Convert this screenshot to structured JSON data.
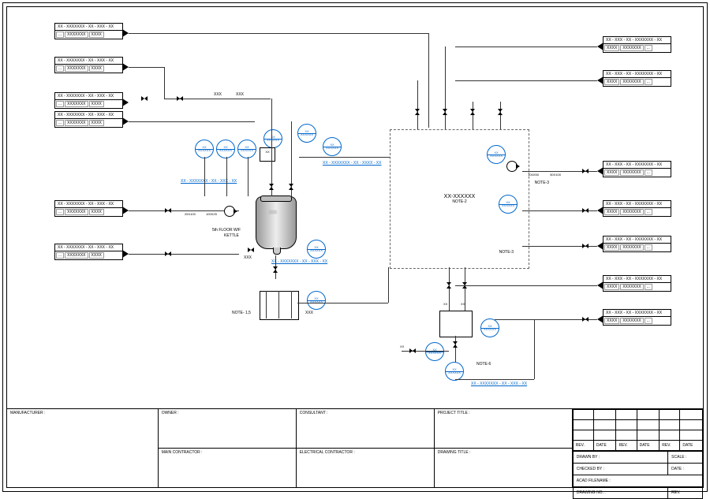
{
  "tags": {
    "left": [
      {
        "hdr": "XX - XXXXXXX - XX - XXX - XX",
        "row": [
          "...",
          "XXXXXXX",
          "XXXX"
        ]
      },
      {
        "hdr": "XX - XXXXXXX - XX - XXX - XX",
        "row": [
          "...",
          "XXXXXXX",
          "XXXX"
        ]
      },
      {
        "hdr": "XX - XXXXXXX - XX - XXX - XX",
        "row": [
          "...",
          "XXXXXXX",
          "XXXX"
        ]
      },
      {
        "hdr": "XX - XXXXXXX - XX - XXX - XX",
        "row": [
          "...",
          "XXXXXXX",
          "XXXX"
        ]
      },
      {
        "hdr": "XX - XXXXXXX - XX - XXX - XX",
        "row": [
          "...",
          "XXXXXXX",
          "XXXX"
        ]
      },
      {
        "hdr": "XX - XXXXXXX - XX - XXX - XX",
        "row": [
          "...",
          "XXXXXXX",
          "XXXX"
        ]
      }
    ],
    "right": [
      {
        "hdr": "XX - XXX - XX - XXXXXXX - XX",
        "row": [
          "XXXX",
          "XXXXXXX",
          "..."
        ]
      },
      {
        "hdr": "XX - XXX - XX - XXXXXXX - XX",
        "row": [
          "XXXX",
          "XXXXXXX",
          "..."
        ]
      },
      {
        "hdr": "XX - XXX - XX - XXXXXXX - XX",
        "row": [
          "XXXX",
          "XXXXXXX",
          "..."
        ]
      },
      {
        "hdr": "XX - XXX - XX - XXXXXXX - XX",
        "row": [
          "XXXX",
          "XXXXXXX",
          "..."
        ]
      },
      {
        "hdr": "XX - XXX - XX - XXXXXXX - XX",
        "row": [
          "XXXX",
          "XXXXXXX",
          "..."
        ]
      },
      {
        "hdr": "XX - XXX - XX - XXXXXXX - XX",
        "row": [
          "XXXX",
          "XXXXXXX",
          "..."
        ]
      },
      {
        "hdr": "XX - XXX - XX - XXXXXXX - XX",
        "row": [
          "XXXX",
          "XXXXXXX",
          "..."
        ]
      }
    ]
  },
  "instrument_label": {
    "top": "XX",
    "bot": "XXXXXX"
  },
  "line_labels": {
    "l1": "XX - XXXXXXX - XX - XXXX - XX",
    "l2": "XX - XXXXXXX - XX - XXX - XX",
    "l3": "XX - XXXXXXX - XX - XXX - XX",
    "l4": "XX - XXXXXXX - XX - XXX - XX"
  },
  "notes": {
    "xxx": "XXX",
    "xx": "XX",
    "floor": "5th FLOOR W/F",
    "kettle": "KETTLE",
    "n2": "NOTE-2",
    "n3": "NOTE-3",
    "n3b": "NOTE-3",
    "n6": "NOTE-6",
    "n15": "NOTE- 1,5",
    "red1": "25X100",
    "red2": "100X25",
    "red3": "50X100",
    "red4": "100X50",
    "box": "XXX"
  },
  "vessel": {
    "id": "XX-XXXXXX",
    "note": "NOTE-2"
  },
  "reactor_text": "XXX",
  "title": {
    "manufacturer": "MANUFACTURER :",
    "owner": "OWNER :",
    "consultant": "CONSULTANT :",
    "project": "PROJECT TITLE :",
    "main": "MAIN CONTRACTOR :",
    "elec": "ELECTRICAL CONTRACTOR :",
    "drawing": "DRAWING TITLE :",
    "rev": "REV.",
    "date": "DATE",
    "drawn": "DRAWN BY :",
    "scale": "SCALE :",
    "checked": "CHECKED BY :",
    "date2": "DATE :",
    "acad": "ACAD FILENAME :",
    "dno": "DRAWING NO. :",
    "rev2": "REV."
  }
}
